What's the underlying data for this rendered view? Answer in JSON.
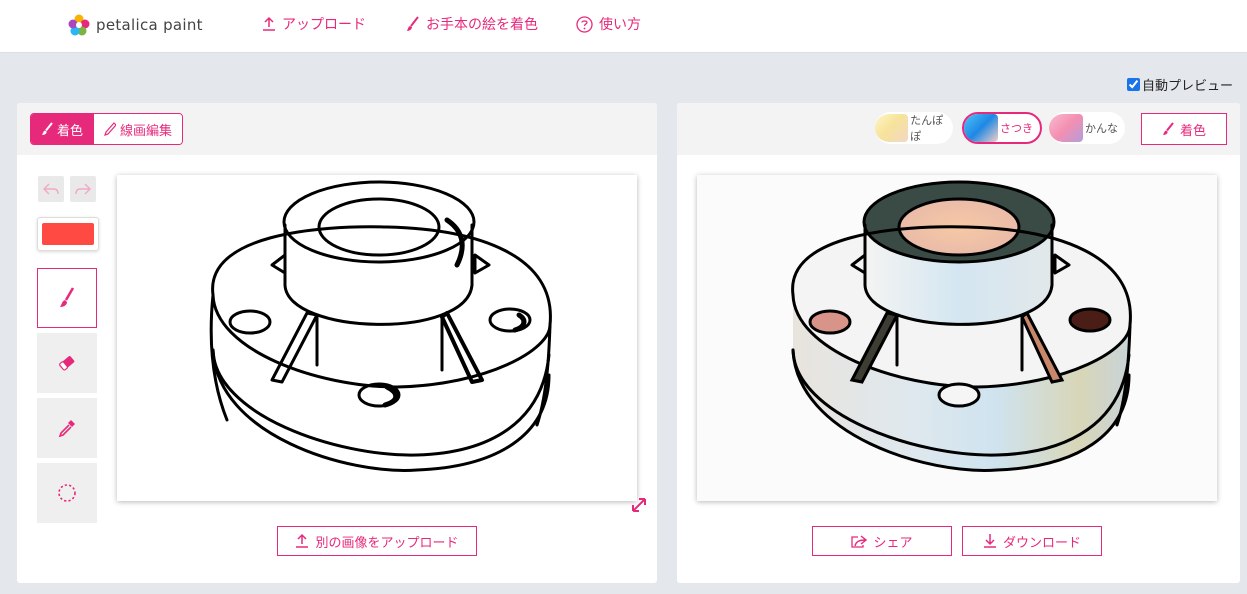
{
  "app": {
    "logo_text": "petalica paint"
  },
  "nav": {
    "upload": "アップロード",
    "sample": "お手本の絵を着色",
    "howto": "使い方"
  },
  "auto_preview": {
    "label": "自動プレビュー",
    "checked": true
  },
  "left_panel": {
    "mode_tabs": [
      {
        "label": "着色",
        "active": true
      },
      {
        "label": "線画編集",
        "active": false
      }
    ],
    "current_color": "#ff4a43",
    "tools": [
      "brush-tool",
      "eraser-tool",
      "eyedropper-tool",
      "hint-tool"
    ],
    "active_tool": "brush-tool",
    "upload_other_label": "別の画像をアップロード"
  },
  "right_panel": {
    "styles": [
      {
        "label": "たんぽぽ",
        "selected": false
      },
      {
        "label": "さつき",
        "selected": true
      },
      {
        "label": "かんな",
        "selected": false
      }
    ],
    "colorize_label": "着色",
    "share_label": "シェア",
    "download_label": "ダウンロード"
  },
  "colors": {
    "accent": "#e7297b",
    "background": "#e4e7eb"
  }
}
